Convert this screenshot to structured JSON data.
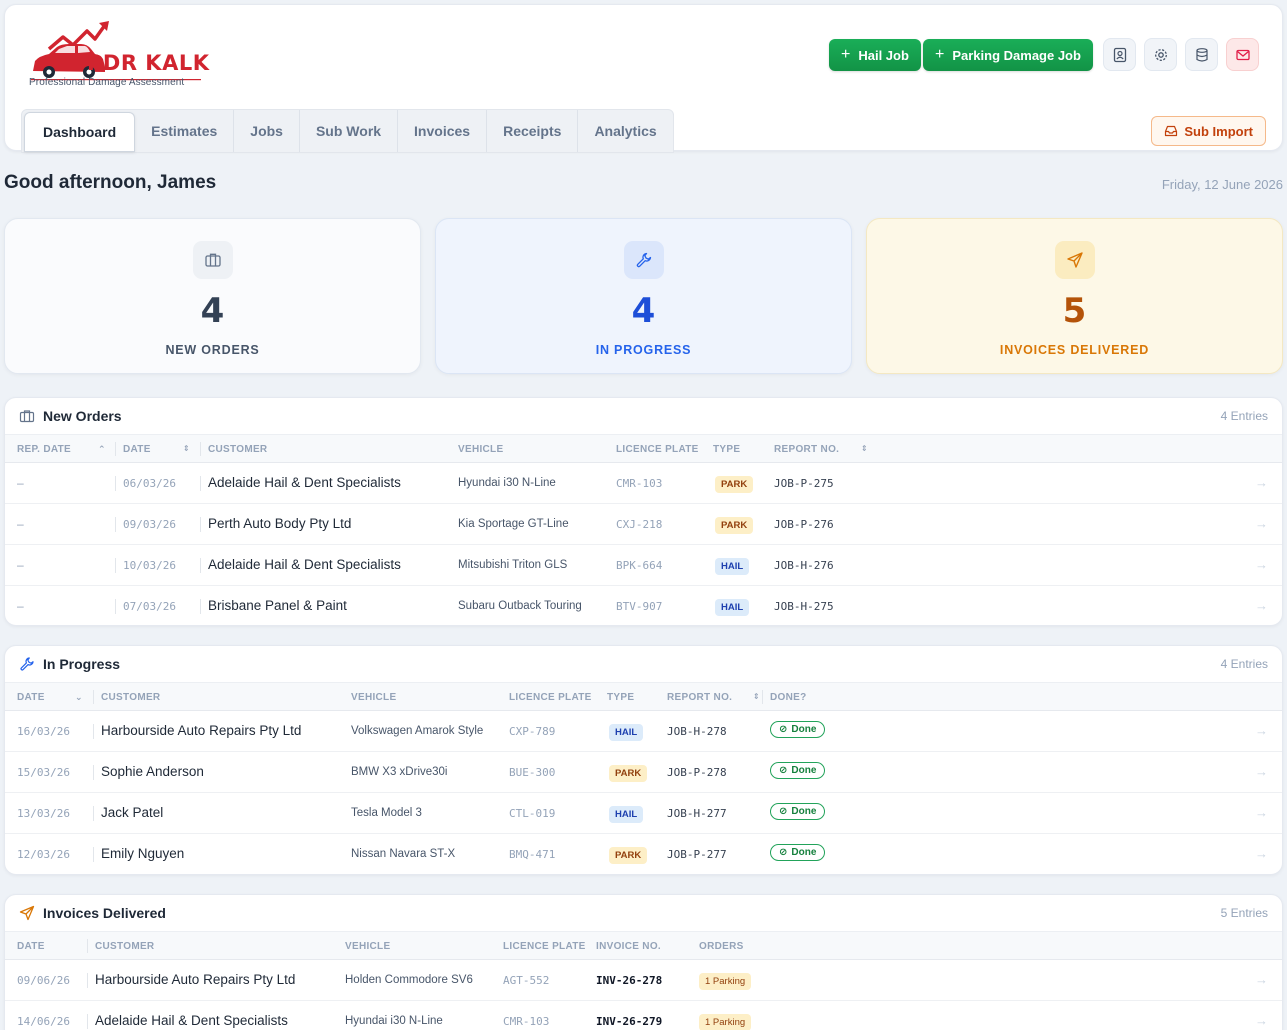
{
  "brand": {
    "name": "PDR KALK",
    "tagline": "Professional Damage Assessment"
  },
  "header": {
    "hail_job_label": "Hail Job",
    "parking_damage_job_label": "Parking Damage Job",
    "icons": [
      "contact-book-icon",
      "gear-icon",
      "database-icon",
      "mail-icon"
    ]
  },
  "tabs": [
    "Dashboard",
    "Estimates",
    "Jobs",
    "Sub Work",
    "Invoices",
    "Receipts",
    "Analytics"
  ],
  "sub_import_label": "Sub Import",
  "greeting": "Good afternoon, James",
  "date": "Friday, 12 June 2026",
  "stats": [
    {
      "value": "4",
      "label": "NEW ORDERS"
    },
    {
      "value": "4",
      "label": "IN PROGRESS"
    },
    {
      "value": "5",
      "label": "INVOICES DELIVERED"
    }
  ],
  "new_orders": {
    "title": "New Orders",
    "count": "4 Entries",
    "columns": [
      "REP. DATE",
      "DATE",
      "CUSTOMER",
      "VEHICLE",
      "LICENCE PLATE",
      "TYPE",
      "REPORT NO."
    ],
    "rows": [
      {
        "rep_date": "–",
        "date": "06/03/26",
        "customer": "Adelaide Hail & Dent Specialists",
        "vehicle": "Hyundai i30 N-Line",
        "plate": "CMR-103",
        "type": "PARK",
        "report": "JOB-P-275"
      },
      {
        "rep_date": "–",
        "date": "09/03/26",
        "customer": "Perth Auto Body Pty Ltd",
        "vehicle": "Kia Sportage GT-Line",
        "plate": "CXJ-218",
        "type": "PARK",
        "report": "JOB-P-276"
      },
      {
        "rep_date": "–",
        "date": "10/03/26",
        "customer": "Adelaide Hail & Dent Specialists",
        "vehicle": "Mitsubishi Triton GLS",
        "plate": "BPK-664",
        "type": "HAIL",
        "report": "JOB-H-276"
      },
      {
        "rep_date": "–",
        "date": "07/03/26",
        "customer": "Brisbane Panel & Paint",
        "vehicle": "Subaru Outback Touring",
        "plate": "BTV-907",
        "type": "HAIL",
        "report": "JOB-H-275"
      }
    ]
  },
  "in_progress": {
    "title": "In Progress",
    "count": "4 Entries",
    "columns": [
      "DATE",
      "CUSTOMER",
      "VEHICLE",
      "LICENCE PLATE",
      "TYPE",
      "REPORT NO.",
      "DONE?"
    ],
    "rows": [
      {
        "date": "16/03/26",
        "customer": "Harbourside Auto Repairs Pty Ltd",
        "vehicle": "Volkswagen Amarok Style",
        "plate": "CXP-789",
        "type": "HAIL",
        "report": "JOB-H-278",
        "done": "Done"
      },
      {
        "date": "15/03/26",
        "customer": "Sophie Anderson",
        "vehicle": "BMW X3 xDrive30i",
        "plate": "BUE-300",
        "type": "PARK",
        "report": "JOB-P-278",
        "done": "Done"
      },
      {
        "date": "13/03/26",
        "customer": "Jack Patel",
        "vehicle": "Tesla Model 3",
        "plate": "CTL-019",
        "type": "HAIL",
        "report": "JOB-H-277",
        "done": "Done"
      },
      {
        "date": "12/03/26",
        "customer": "Emily Nguyen",
        "vehicle": "Nissan Navara ST-X",
        "plate": "BMQ-471",
        "type": "PARK",
        "report": "JOB-P-277",
        "done": "Done"
      }
    ]
  },
  "invoices_delivered": {
    "title": "Invoices Delivered",
    "count": "5 Entries",
    "columns": [
      "DATE",
      "CUSTOMER",
      "VEHICLE",
      "LICENCE PLATE",
      "INVOICE NO.",
      "ORDERS"
    ],
    "rows": [
      {
        "date": "09/06/26",
        "customer": "Harbourside Auto Repairs Pty Ltd",
        "vehicle": "Holden Commodore SV6",
        "plate": "AGT-552",
        "invoice": "INV-26-278",
        "orders": "1 Parking"
      },
      {
        "date": "14/06/26",
        "customer": "Adelaide Hail & Dent Specialists",
        "vehicle": "Hyundai i30 N-Line",
        "plate": "CMR-103",
        "invoice": "INV-26-279",
        "orders": "1 Parking"
      }
    ]
  },
  "colors": {
    "brand_red": "#d1242f",
    "green": "#16a34a",
    "blue": "#1d4ed8",
    "amber": "#b45309"
  }
}
